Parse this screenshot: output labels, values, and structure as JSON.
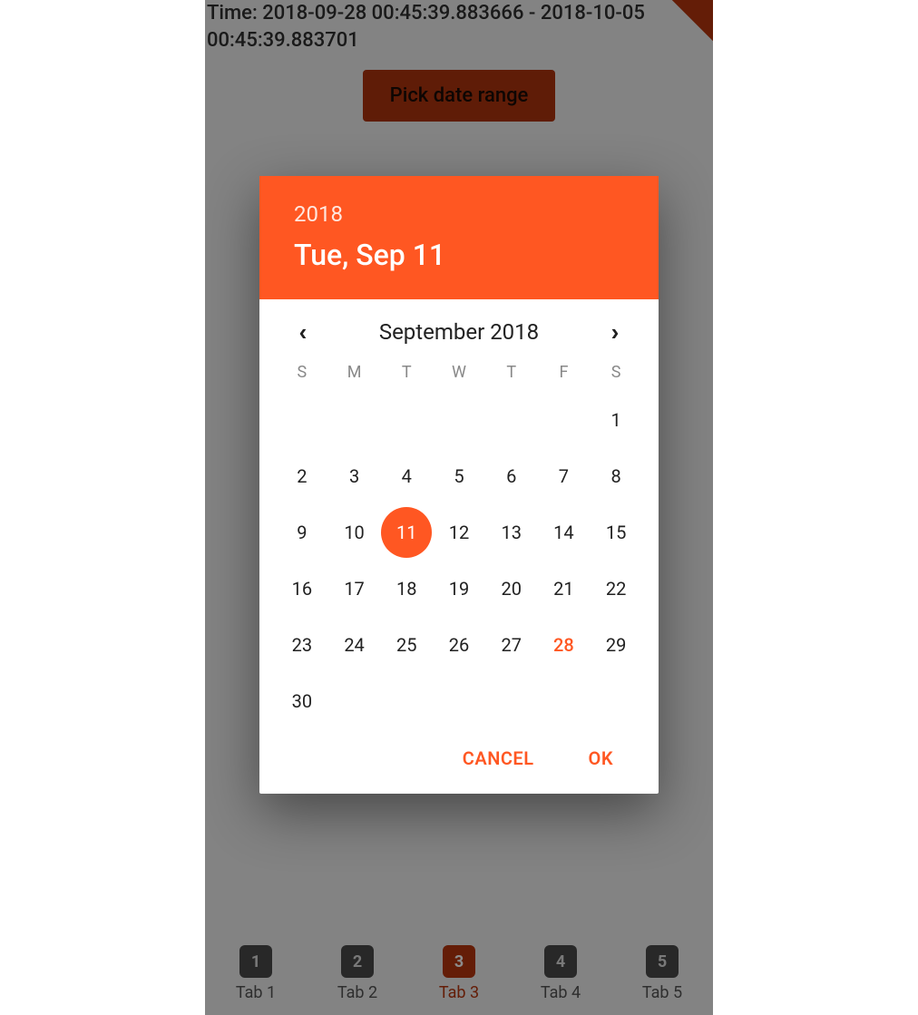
{
  "colors": {
    "accent": "#ff5722",
    "accent_dark": "#b7360e"
  },
  "background": {
    "time_line1": "Time: 2018-09-28 00:45:39.883666 - 2018-10-05",
    "time_line2": "00:45:39.883701",
    "pick_button": "Pick date range"
  },
  "tabs": [
    {
      "num": "1",
      "label": "Tab 1",
      "active": false
    },
    {
      "num": "2",
      "label": "Tab 2",
      "active": false
    },
    {
      "num": "3",
      "label": "Tab 3",
      "active": true
    },
    {
      "num": "4",
      "label": "Tab 4",
      "active": false
    },
    {
      "num": "5",
      "label": "Tab 5",
      "active": false
    }
  ],
  "picker": {
    "year": "2018",
    "date": "Tue, Sep 11",
    "month_label": "September 2018",
    "weekdays": [
      "S",
      "M",
      "T",
      "W",
      "T",
      "F",
      "S"
    ],
    "leading_blanks": 6,
    "days_in_month": 30,
    "selected_day": 11,
    "today_day": 28,
    "actions": {
      "cancel": "CANCEL",
      "ok": "OK"
    }
  }
}
